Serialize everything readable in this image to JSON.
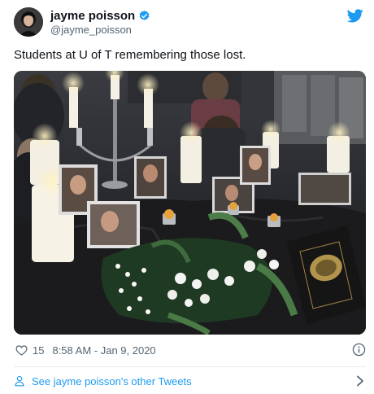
{
  "author": {
    "display_name": "jayme poisson",
    "handle": "@jayme_poisson",
    "verified_icon": "verified-badge-icon",
    "avatar_icon": "avatar"
  },
  "tweet": {
    "text": "Students at U of T remembering those lost.",
    "media_description": "photo"
  },
  "meta": {
    "likes": "15",
    "timestamp": "8:58 AM - Jan 9, 2020"
  },
  "footer": {
    "link_text": "See jayme poisson's other Tweets"
  },
  "colors": {
    "brand_blue": "#1d9bf0",
    "secondary_text": "#536471",
    "divider": "#e6ecf0"
  }
}
